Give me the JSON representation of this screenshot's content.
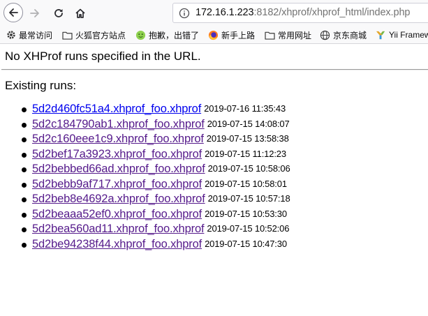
{
  "browser": {
    "url_host": "172.16.1.223",
    "url_rest": ":8182/xhprof/xhprof_html/index.php"
  },
  "bookmarks": [
    {
      "label": "最常访问",
      "icon": "gear-icon"
    },
    {
      "label": "火狐官方站点",
      "icon": "folder-icon"
    },
    {
      "label": "抱歉，出错了",
      "icon": "smiley-icon"
    },
    {
      "label": "新手上路",
      "icon": "firefox-icon"
    },
    {
      "label": "常用网址",
      "icon": "folder-icon"
    },
    {
      "label": "京东商城",
      "icon": "globe-icon"
    },
    {
      "label": "Yii Framew",
      "icon": "yii-icon"
    }
  ],
  "page": {
    "message": "No XHProf runs specified in the URL.",
    "existing_label": "Existing runs:",
    "runs": [
      {
        "name": "5d2d460fc51a4.xhprof_foo.xhprof",
        "time": "2019-07-16 11:35:43"
      },
      {
        "name": "5d2c184790ab1.xhprof_foo.xhprof",
        "time": "2019-07-15 14:08:07"
      },
      {
        "name": "5d2c160eee1c9.xhprof_foo.xhprof",
        "time": "2019-07-15 13:58:38"
      },
      {
        "name": "5d2bef17a3923.xhprof_foo.xhprof",
        "time": "2019-07-15 11:12:23"
      },
      {
        "name": "5d2bebbed66ad.xhprof_foo.xhprof",
        "time": "2019-07-15 10:58:06"
      },
      {
        "name": "5d2bebb9af717.xhprof_foo.xhprof",
        "time": "2019-07-15 10:58:01"
      },
      {
        "name": "5d2beb8e4692a.xhprof_foo.xhprof",
        "time": "2019-07-15 10:57:18"
      },
      {
        "name": "5d2beaaa52ef0.xhprof_foo.xhprof",
        "time": "2019-07-15 10:53:30"
      },
      {
        "name": "5d2bea560ad11.xhprof_foo.xhprof",
        "time": "2019-07-15 10:52:06"
      },
      {
        "name": "5d2be94238f44.xhprof_foo.xhprof",
        "time": "2019-07-15 10:47:30"
      }
    ]
  },
  "colors": {
    "link_visited": "#551a8b",
    "link_unvisited": "#0000ee"
  }
}
